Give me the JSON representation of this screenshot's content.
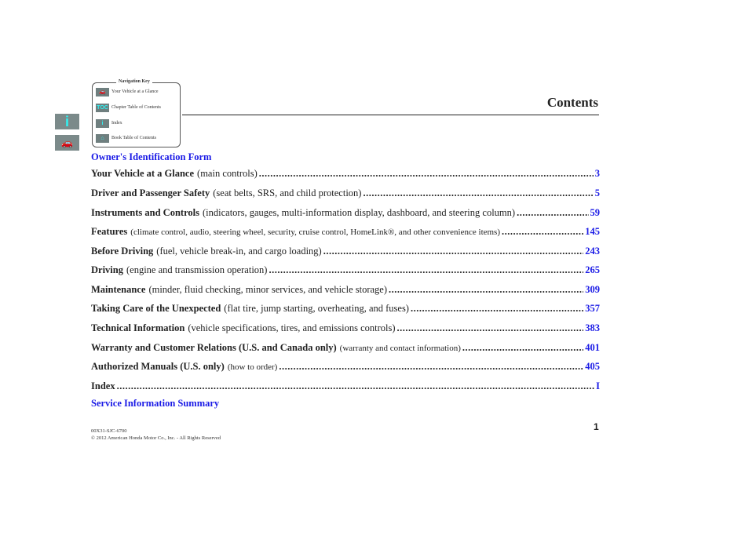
{
  "nav_key": {
    "title": "Navigation Key",
    "items": [
      {
        "icon": "car-icon",
        "glyph": "🚗",
        "label": "Your Vehicle at a Glance"
      },
      {
        "icon": "toc-icon",
        "glyph": "TOC",
        "label": "Chapter Table of Contents"
      },
      {
        "icon": "info-icon",
        "glyph": "i",
        "label": "Index"
      },
      {
        "icon": "home-icon",
        "glyph": "⌂",
        "label": "Book Table of Contents"
      }
    ]
  },
  "side_icons": [
    {
      "icon": "info-icon",
      "glyph": "i"
    },
    {
      "icon": "car-icon",
      "glyph": "🚗"
    }
  ],
  "page_title": "Contents",
  "owners_form": "Owner's Identification Form",
  "toc": [
    {
      "title": "Your Vehicle at a Glance",
      "desc": "(main controls)",
      "page": "3"
    },
    {
      "title": "Driver and Passenger Safety",
      "desc": "(seat belts, SRS, and child protection)",
      "page": "5"
    },
    {
      "title": "Instruments and Controls",
      "desc": "(indicators, gauges, multi-information display, dashboard, and steering column)",
      "page": "59"
    },
    {
      "title": "Features",
      "desc": "(climate control, audio, steering wheel, security, cruise control, HomeLink®, and other convenience items)",
      "page": "145"
    },
    {
      "title": "Before Driving",
      "desc": "(fuel, vehicle break-in, and cargo loading)",
      "page": "243"
    },
    {
      "title": "Driving",
      "desc": "(engine and transmission operation)",
      "page": "265"
    },
    {
      "title": "Maintenance",
      "desc": "(minder, fluid checking, minor services, and vehicle storage)",
      "page": "309"
    },
    {
      "title": "Taking Care of the Unexpected",
      "desc": "(flat tire, jump starting, overheating, and fuses)",
      "page": "357"
    },
    {
      "title": "Technical Information",
      "desc": "(vehicle specifications, tires, and emissions controls)",
      "page": "383"
    },
    {
      "title": "Warranty and Customer Relations (U.S. and Canada only)",
      "desc": "(warranty and contact information)",
      "page": "401"
    },
    {
      "title": "Authorized Manuals (U.S. only)",
      "desc": "(how to order)",
      "page": "405"
    },
    {
      "title": "Index",
      "desc": "",
      "page": "I"
    }
  ],
  "service_summary": "Service Information Summary",
  "footer": {
    "code": "00X31-SJC-6700",
    "copyright": "© 2012 American Honda Motor Co., Inc. - All Rights Reserved"
  },
  "page_number": "1"
}
